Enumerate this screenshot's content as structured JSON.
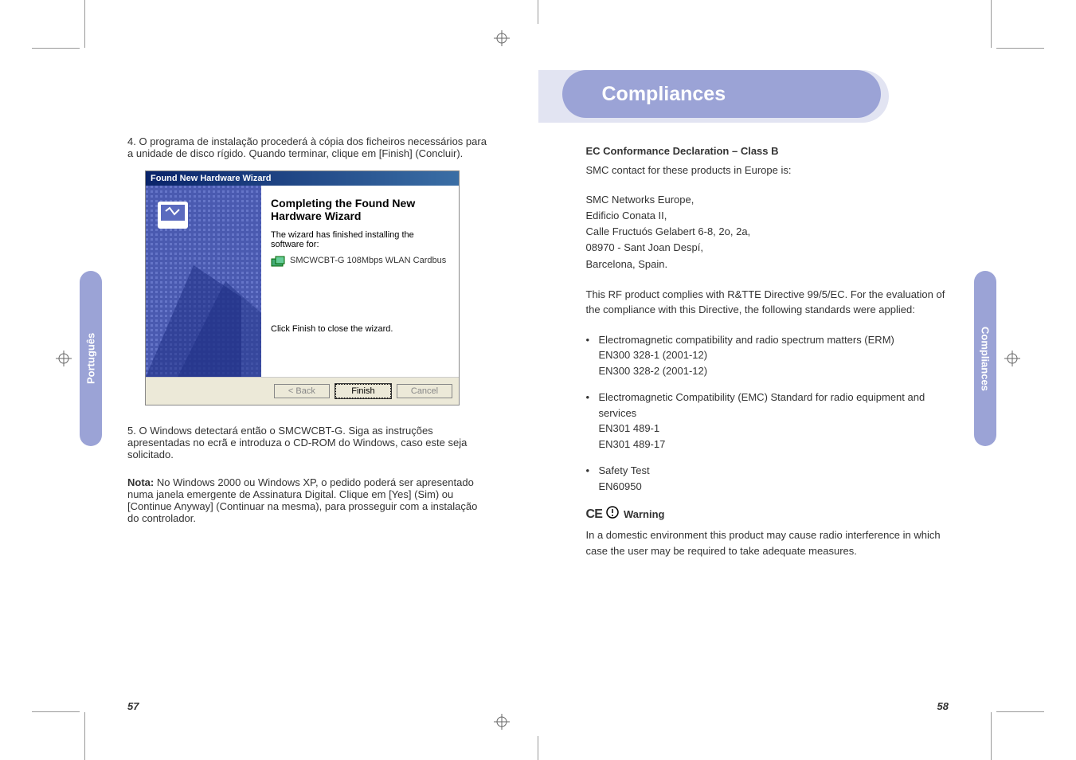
{
  "left": {
    "tab": "Português",
    "step4_num": "4.",
    "step4": "O programa de instalação procederá à cópia dos ficheiros necessários para a unidade de disco rígido. Quando terminar, clique em [Finish] (Concluir).",
    "step5_num": "5.",
    "step5": "O Windows detectará então o SMCWCBT-G. Siga as instruções apresentadas no ecrã e introduza o CD-ROM do Windows, caso este seja solicitado.",
    "note_label": "Nota:",
    "note": "No Windows 2000 ou Windows XP, o pedido poderá ser apresentado numa janela emergente de Assinatura Digital. Clique em [Yes] (Sim) ou [Continue Anyway] (Continuar na mesma), para prosseguir com a instalação do controlador.",
    "dialog": {
      "title": "Found New Hardware Wizard",
      "heading": "Completing the Found New Hardware Wizard",
      "line1": "The wizard has finished installing the software for:",
      "device": "SMCWCBT-G 108Mbps WLAN Cardbus",
      "close_hint": "Click Finish to close the wizard.",
      "btn_back": "< Back",
      "btn_finish": "Finish",
      "btn_cancel": "Cancel"
    },
    "pagenum": "57"
  },
  "right": {
    "tab": "Compliances",
    "heading": "Compliances",
    "ec_title": "EC Conformance Declaration – Class B",
    "ec_sub": "SMC contact for these products in Europe is:",
    "addr1": "SMC Networks Europe,",
    "addr2": "Edificio Conata II,",
    "addr3": "Calle Fructuós Gelabert 6-8, 2o, 2a,",
    "addr4": "08970 - Sant Joan Despí,",
    "addr5": "Barcelona, Spain.",
    "rf_para": "This RF product complies with R&TTE Directive 99/5/EC. For the evaluation of the compliance with this Directive, the following standards were applied:",
    "b1": "Electromagnetic compatibility and radio spectrum matters (ERM)",
    "b1a": "EN300 328-1 (2001-12)",
    "b1b": "EN300 328-2 (2001-12)",
    "b2": "Electromagnetic Compatibility (EMC) Standard for radio equipment and services",
    "b2a": "EN301 489-1",
    "b2b": "EN301 489-17",
    "b3": "Safety Test",
    "b3a": "EN60950",
    "warn_label": "Warning",
    "warn_text": "In a domestic environment this product may cause radio interference in which case the user may be required to take adequate measures.",
    "pagenum": "58"
  }
}
